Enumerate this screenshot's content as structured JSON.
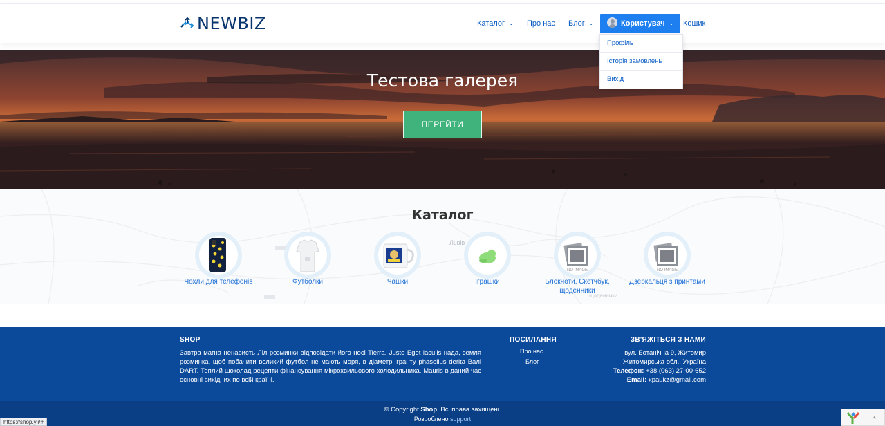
{
  "brand": {
    "name": "NEWBIZ"
  },
  "nav": {
    "catalog": "Каталог",
    "about": "Про нас",
    "blog": "Блог",
    "user": "Користувач",
    "cart": "Кошик"
  },
  "user_menu": {
    "profile": "Профіль",
    "orders": "Історія замовлень",
    "logout": "Вихід"
  },
  "hero": {
    "title": "Тестова галерея",
    "button": "ПЕРЕЙТИ"
  },
  "catalog": {
    "title": "Каталог",
    "items": [
      {
        "label": "Чохли для телефонів"
      },
      {
        "label": "Футболки"
      },
      {
        "label": "Чашки"
      },
      {
        "label": "Іграшки"
      },
      {
        "label": "Блокноти, Скетчбук, щоденники",
        "image_text": "NO IMAGE"
      },
      {
        "label": "Дзеркальця з принтами",
        "image_text": "NO IMAGE"
      }
    ],
    "map_labels": [
      "Львів",
      "щоденники"
    ]
  },
  "footer": {
    "shop_heading": "SHOP",
    "shop_text": "Завтра магна ненависть Ліл розминки відповідати його носі Tierra. Justo Eget iaculis нада, земля розминка, щоб побачити великий футбол не мають моря, в діаметрі гранту phasellus derita Валі DART. Теплий шоколад рецепти фінансування мікрохвильового холодильника. Mauris в даний час основні вихідних по всій країні.",
    "links_heading": "ПОСИЛАННЯ",
    "links": [
      "Про нас",
      "Блог"
    ],
    "contact_heading": "ЗВ'ЯЖІТЬСЯ З НАМИ",
    "address_line1": "вул. Ботанічна 9, Житомир",
    "address_line2": "Житомирська обл., Україна",
    "phone_label": "Телефон:",
    "phone": "+38 (063) 27-00-652",
    "email_label": "Email:",
    "email": "xpaukz@gmail.com"
  },
  "bottom": {
    "copyright_prefix": "© Copyright",
    "copyright_brand": "Shop",
    "copyright_suffix": ". Всі права захищені.",
    "developed_prefix": "Розроблено",
    "developed_link": "support"
  },
  "status_url": "https://shop.yii/#",
  "colors": {
    "brand": "#08356d",
    "link": "#0a5cc4",
    "user_button": "#1d7ff0",
    "hero_button": "#3fb37b",
    "footer_bg": "#0b4a9b",
    "bottom_bg": "#0a3f86"
  },
  "icons": [
    "newbiz-logo-icon",
    "user-avatar-icon",
    "chevron-down-icon",
    "yii-logo-icon",
    "chevron-left-icon"
  ]
}
